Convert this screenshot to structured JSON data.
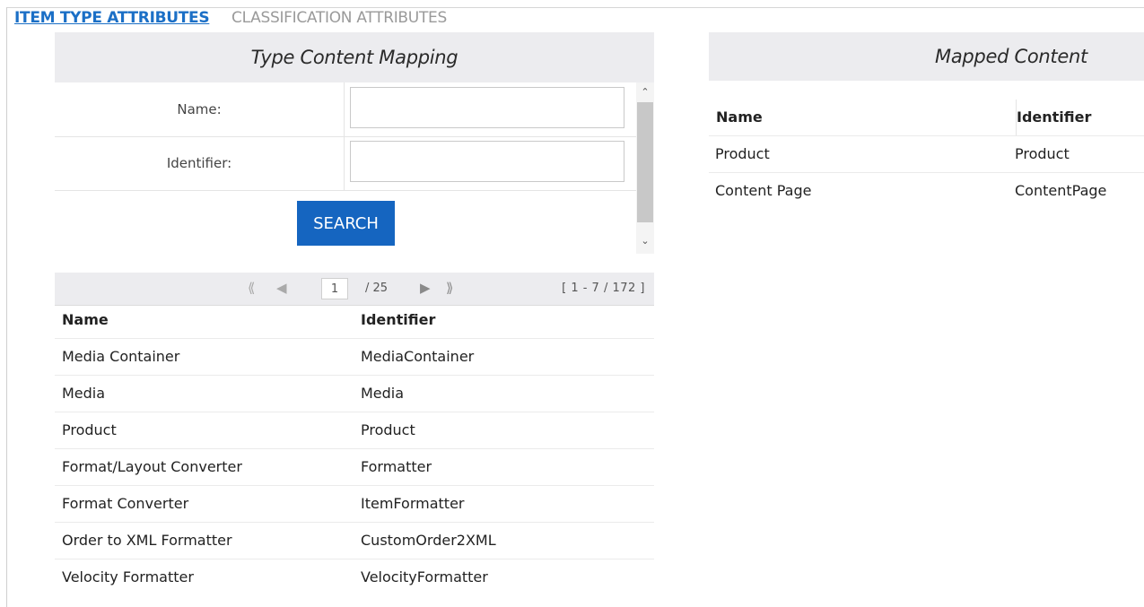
{
  "tabs": [
    {
      "label": "ITEM TYPE ATTRIBUTES"
    },
    {
      "label": "CLASSIFICATION ATTRIBUTES"
    }
  ],
  "left_panel": {
    "title": "Type Content Mapping",
    "form": {
      "name_label": "Name:",
      "identifier_label": "Identifier:",
      "name_value": "",
      "identifier_value": "",
      "search_label": "SEARCH"
    },
    "pager": {
      "page": "1",
      "total": "/ 25",
      "range": "[ 1 - 7 / 172 ]",
      "icons": [
        "first-page-icon",
        "prev-page-icon",
        "next-page-icon",
        "last-page-icon"
      ]
    },
    "grid": {
      "columns": [
        "Name",
        "Identifier"
      ],
      "rows": [
        [
          "Media Container",
          "MediaContainer"
        ],
        [
          "Media",
          "Media"
        ],
        [
          "Product",
          "Product"
        ],
        [
          "Format/Layout Converter",
          "Formatter"
        ],
        [
          "Format Converter",
          "ItemFormatter"
        ],
        [
          "Order to XML Formatter",
          "CustomOrder2XML"
        ],
        [
          "Velocity Formatter",
          "VelocityFormatter"
        ]
      ]
    }
  },
  "right_panel": {
    "title": "Mapped Content",
    "grid": {
      "columns": [
        "Name",
        "Identifier"
      ],
      "rows": [
        [
          "Product",
          "Product"
        ],
        [
          "Content Page",
          "ContentPage"
        ]
      ]
    }
  },
  "colors": {
    "accent": "#1b6fc6",
    "button": "#1565c0",
    "header_bg": "#ececef"
  }
}
